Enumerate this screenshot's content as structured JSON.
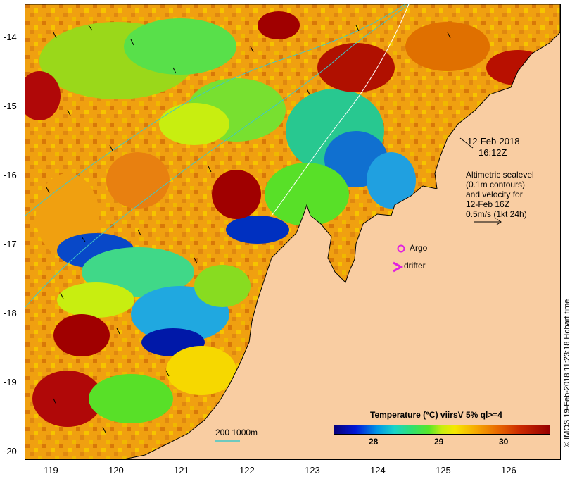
{
  "map": {
    "latitude_ticks": [
      "-14",
      "-15",
      "-16",
      "-17",
      "-18",
      "-19",
      "-20"
    ],
    "longitude_ticks": [
      "119",
      "120",
      "121",
      "122",
      "123",
      "124",
      "125",
      "126"
    ],
    "timestamp_line1": "12-Feb-2018",
    "timestamp_line2": "16:12Z",
    "sealevel_note": [
      "Altimetric sealevel",
      "(0.1m contours)",
      "and velocity for",
      "12-Feb 16Z",
      "0.5m/s (1kt 24h)"
    ],
    "legend_argo": "Argo",
    "legend_drifter": "drifter",
    "scale_bar_label": "200  1000m",
    "credit": "© IMOS 19-Feb-2018 11:23:18 Hobart time",
    "colorbar_title": "Temperature (°C) viirsV 5% ql>=4",
    "colorbar_ticks": [
      "28",
      "29",
      "30"
    ],
    "colors": {
      "land": "#f9cda2",
      "argo_marker": "#e020e0",
      "drifter_marker": "#e020e0",
      "contour": "#40c8c8",
      "coast": "#000000"
    }
  }
}
